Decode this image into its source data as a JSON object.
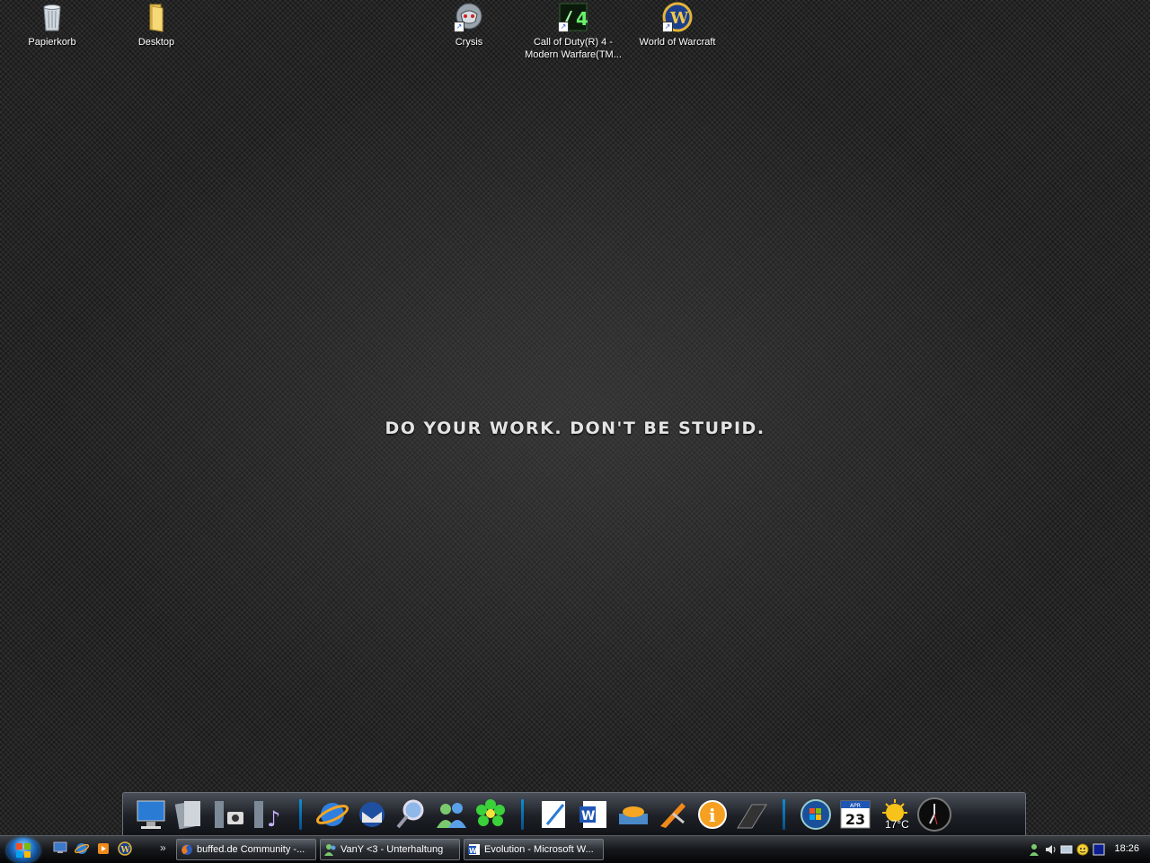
{
  "desktop": {
    "icons": [
      {
        "label": "Papierkorb",
        "icon": "recycle-bin-icon"
      },
      {
        "label": "Desktop",
        "icon": "folder-icon"
      },
      {
        "label": "Crysis",
        "icon": "crysis-icon"
      },
      {
        "label": "Call of Duty(R) 4 - Modern Warfare(TM...",
        "icon": "cod4-icon"
      },
      {
        "label": "World of Warcraft",
        "icon": "wow-icon"
      }
    ],
    "wallpaper_text": "DO YOUR WORK. DON'T BE STUPID."
  },
  "dock": {
    "weather_temp": "17°C",
    "calendar_day": "23",
    "calendar_month": "APR"
  },
  "taskbar": {
    "tasks": [
      {
        "label": "buffed.de Community -...",
        "icon": "firefox-icon"
      },
      {
        "label": "VanY <3 - Unterhaltung",
        "icon": "messenger-icon"
      },
      {
        "label": "Evolution - Microsoft W...",
        "icon": "word-icon"
      }
    ],
    "clock": "18:26"
  },
  "colors": {
    "accent": "#0a8fd8",
    "wallpaper": "#262626"
  }
}
